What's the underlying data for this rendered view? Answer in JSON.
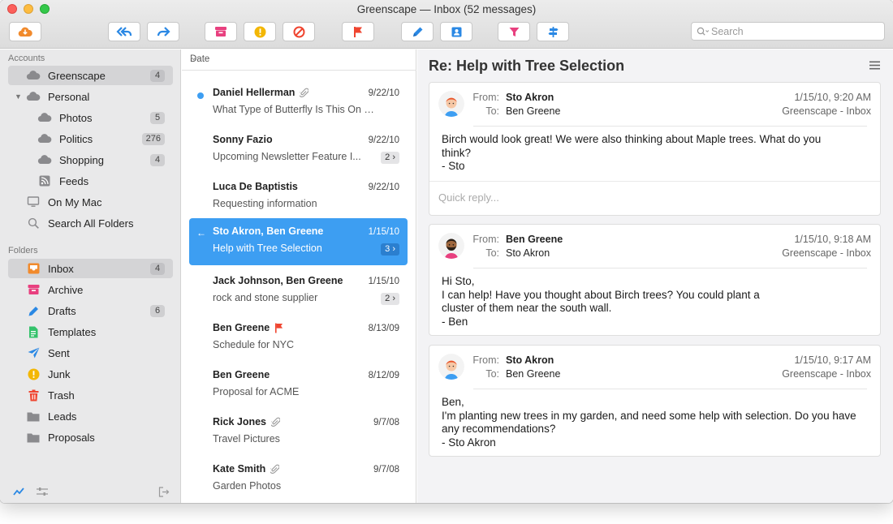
{
  "window": {
    "title": "Greenscape — Inbox (52 messages)"
  },
  "search": {
    "placeholder": "Search"
  },
  "colors": {
    "accent": "#3d9ef2",
    "orange": "#f18a2c",
    "pink": "#e8407f",
    "yellow": "#f3b705",
    "red": "#ef4530",
    "blue": "#2a88e4",
    "green": "#34c26b"
  },
  "sidebar": {
    "accounts_header": "Accounts",
    "accounts": [
      {
        "label": "Greenscape",
        "badge": "4"
      },
      {
        "label": "Personal"
      },
      {
        "label": "Photos",
        "badge": "5"
      },
      {
        "label": "Politics",
        "badge": "276"
      },
      {
        "label": "Shopping",
        "badge": "4"
      },
      {
        "label": "Feeds"
      },
      {
        "label": "On My Mac"
      },
      {
        "label": "Search All Folders"
      }
    ],
    "folders_header": "Folders",
    "folders": [
      {
        "label": "Inbox",
        "badge": "4"
      },
      {
        "label": "Archive"
      },
      {
        "label": "Drafts",
        "badge": "6"
      },
      {
        "label": "Templates"
      },
      {
        "label": "Sent"
      },
      {
        "label": "Junk"
      },
      {
        "label": "Trash"
      },
      {
        "label": "Leads"
      },
      {
        "label": "Proposals"
      }
    ]
  },
  "list": {
    "sort_label": "Date",
    "messages": [
      {
        "sender": "Daniel Hellerman",
        "date": "9/22/10",
        "subject": "What Type of Butterfly Is This On My F..."
      },
      {
        "sender": "Sonny Fazio",
        "date": "9/22/10",
        "subject": "Upcoming Newsletter Feature I...",
        "count": "2 ›"
      },
      {
        "sender": "Luca De Baptistis",
        "date": "9/22/10",
        "subject": "Requesting information"
      },
      {
        "sender": "Sto Akron, Ben Greene",
        "date": "1/15/10",
        "subject": "Help with Tree Selection",
        "count": "3 ›"
      },
      {
        "sender": "Jack Johnson, Ben Greene",
        "date": "1/15/10",
        "subject": "rock and stone supplier",
        "count": "2 ›"
      },
      {
        "sender": "Ben Greene",
        "date": "8/13/09",
        "subject": "Schedule for NYC"
      },
      {
        "sender": "Ben Greene",
        "date": "8/12/09",
        "subject": "Proposal for ACME"
      },
      {
        "sender": "Rick Jones",
        "date": "9/7/08",
        "subject": "Travel Pictures"
      },
      {
        "sender": "Kate Smith",
        "date": "9/7/08",
        "subject": "Garden Photos"
      }
    ]
  },
  "conversation": {
    "title": "Re: Help with Tree Selection",
    "from_label": "From:",
    "to_label": "To:",
    "quick_reply_placeholder": "Quick reply...",
    "messages": [
      {
        "from": "Sto Akron",
        "to": "Ben Greene",
        "date": "1/15/10, 9:20 AM",
        "mailbox": "Greenscape - Inbox",
        "body": "Birch would look great!  We were also thinking about Maple trees.  What do you\nthink?\n- Sto"
      },
      {
        "from": "Ben Greene",
        "to": "Sto Akron",
        "date": "1/15/10, 9:18 AM",
        "mailbox": "Greenscape - Inbox",
        "body": "Hi Sto,\nI can help!  Have you thought about Birch trees?  You could plant a\ncluster of them near the south wall.\n- Ben"
      },
      {
        "from": "Sto Akron",
        "to": "Ben Greene",
        "date": "1/15/10, 9:17 AM",
        "mailbox": "Greenscape - Inbox",
        "body": "Ben,\nI'm planting new trees in my garden, and need some help with selection.  Do you have\nany recommendations?\n- Sto Akron"
      }
    ]
  }
}
